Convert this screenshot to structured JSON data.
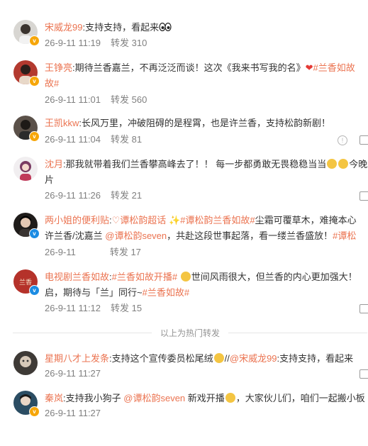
{
  "reposts": [
    {
      "user": "宋威龙99",
      "text": ":支持支持，看起来",
      "time": "26-9-11 11:19",
      "repost_label": "转发 310"
    },
    {
      "user": "王铮亮",
      "text_before": ":期待兰香嘉兰，不再泛泛而谈！这次《我来书写我的名》",
      "tag": "#兰香如故",
      "tag_tail": "故#",
      "time": "26-9-11 11:01",
      "repost_label": "转发 560"
    },
    {
      "user": "王凯kkw",
      "text": ":长风万里，冲破阻碍的是程霄，也是许兰香，支持松韵新剧！",
      "time": "26-9-11 11:04",
      "repost_label": "转发 81"
    },
    {
      "user": "沈月",
      "text": ":那我就带着我们兰香攀高峰去了！！ 每一步都勇敢无畏稳稳当当",
      "text_tail": "今晚",
      "line2": "片",
      "time": "26-9-11 11:26",
      "repost_label": "转发 21"
    },
    {
      "user": "两小姐的便利贴",
      "p1": ":",
      "link1": "谭松韵超话",
      "link2": "#谭松韵兰香如故#",
      "p2": "尘霜可覆草木，难掩本心",
      "line2_a": "许兰香/沈嘉兰",
      "link3": "@谭松韵seven",
      "line2_b": "，共赴这段世事起落，看一缕兰香盛放！",
      "link4": "#谭松",
      "time": "26-9-11",
      "repost_label": "转发 17"
    },
    {
      "user": "电视剧兰香如故",
      "p1": ":",
      "link1": "#兰香如故开播#",
      "p2": "世间风雨很大，但兰香的内心更加强大！",
      "line2_a": "启，期待与「兰」同行~",
      "link2": "#兰香如故#",
      "time": "26-9-11 11:12",
      "repost_label": "转发 15"
    }
  ],
  "divider_label": "以上为热门转发",
  "latest": [
    {
      "user": "星期八才上发条",
      "p1": ":支持这个宣传委员松尾绒",
      "p2": "//",
      "link1": "@宋威龙99",
      "p3": ":支持支持，看起来",
      "time": "26-9-11 11:27"
    },
    {
      "user": "秦岚",
      "p1": ":支持我小狗子",
      "link1": "@谭松韵seven",
      "p2": "新戏开播",
      "p3": "，大家伙儿们，咱们一起搬小板",
      "time": "26-9-11 11:27"
    }
  ],
  "colors": {
    "link": "#eb7350",
    "meta": "#808080",
    "vip": "#f6a609",
    "verified_blue": "#1c8ce3"
  },
  "icons": [
    "eyes-emoji",
    "heart-emoji",
    "alert-icon",
    "reply-icon",
    "super-topic-icon",
    "sparkle-emoji"
  ]
}
